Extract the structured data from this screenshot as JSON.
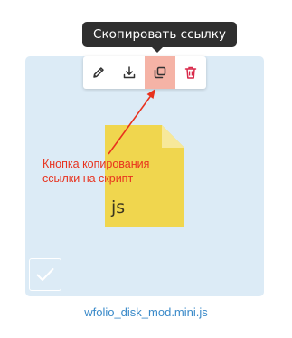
{
  "tooltip": {
    "text": "Скопировать ссылку"
  },
  "toolbar": {
    "buttons": [
      {
        "icon": "pencil-icon",
        "active": false
      },
      {
        "icon": "download-icon",
        "active": false
      },
      {
        "icon": "copy-link-icon",
        "active": true
      },
      {
        "icon": "trash-icon",
        "active": false
      }
    ]
  },
  "file": {
    "extension": "js",
    "name": "wfolio_disk_mod.mini.js",
    "icon": "document-icon"
  },
  "annotation": {
    "line1": "Кнопка копирования",
    "line2": "ссылки на скрипт"
  },
  "checkbox": {
    "icon": "checkmark-icon",
    "checked": false
  },
  "colors": {
    "card_bg": "#dcebf6",
    "tooltip_bg": "#2f2f2f",
    "active_btn_bg": "#f5b3a6",
    "file_icon": "#f0d64e",
    "annotation": "#e8321e",
    "link": "#3a8ac9",
    "trash": "#d9294a"
  }
}
